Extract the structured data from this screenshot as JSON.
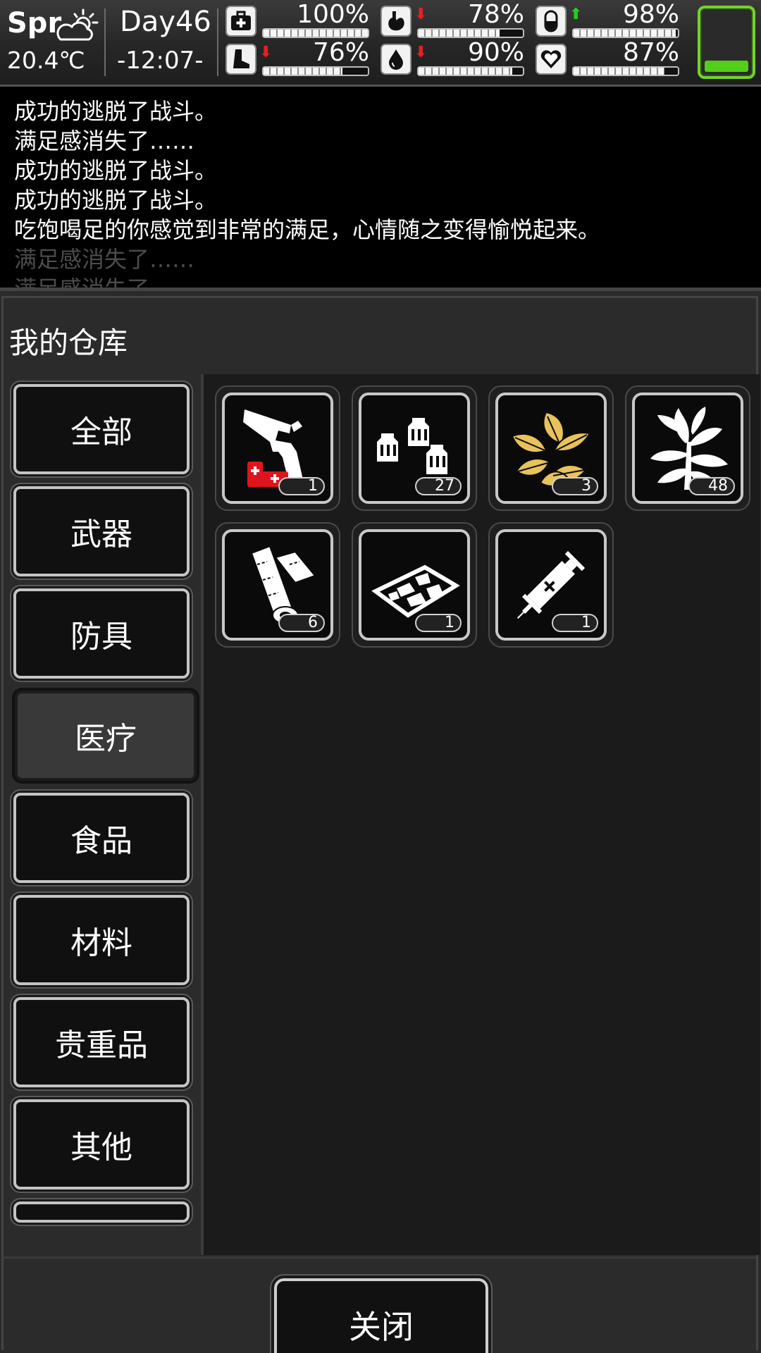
{
  "hud": {
    "season": "Spr",
    "weather_icon": "partly-cloudy-sun-icon",
    "temperature": "20.4℃",
    "day": "Day46",
    "clock": "-12:07-",
    "stats": [
      {
        "icon": "first-aid-kit-icon",
        "value": "100%",
        "level": 1.0,
        "trend": ""
      },
      {
        "icon": "stomach-icon",
        "value": "78%",
        "level": 0.78,
        "trend": "down"
      },
      {
        "icon": "pill-capsule-icon",
        "value": "98%",
        "level": 0.98,
        "trend": "up"
      },
      {
        "icon": "boot-icon",
        "value": "76%",
        "level": 0.76,
        "trend": "down"
      },
      {
        "icon": "water-drop-icon",
        "value": "90%",
        "level": 0.9,
        "trend": "down"
      },
      {
        "icon": "heart-icon",
        "value": "87%",
        "level": 0.87,
        "trend": ""
      }
    ],
    "trend_glyphs": {
      "down": "⬇",
      "up": "⬆"
    },
    "colors": {
      "trend_down": "#e62020",
      "trend_up": "#22d022",
      "status_box": "#74d22b"
    }
  },
  "log": {
    "lines": [
      {
        "text": "成功的逃脱了战斗。",
        "dim": false
      },
      {
        "text": "满足感消失了……",
        "dim": false
      },
      {
        "text": "成功的逃脱了战斗。",
        "dim": false
      },
      {
        "text": "成功的逃脱了战斗。",
        "dim": false
      },
      {
        "text": "吃饱喝足的你感觉到非常的满足，心情随之变得愉悦起来。",
        "dim": false
      },
      {
        "text": "满足感消失了……",
        "dim": true
      },
      {
        "text": "满足感消失了……",
        "dim": true
      }
    ]
  },
  "warehouse": {
    "title": "我的仓库",
    "categories": [
      {
        "label": "全部",
        "selected": false
      },
      {
        "label": "武器",
        "selected": false
      },
      {
        "label": "防具",
        "selected": false
      },
      {
        "label": "医疗",
        "selected": true
      },
      {
        "label": "食品",
        "selected": false
      },
      {
        "label": "材料",
        "selected": false
      },
      {
        "label": "贵重品",
        "selected": false
      },
      {
        "label": "其他",
        "selected": false
      }
    ],
    "items": [
      {
        "icon": "flare-gun-icon",
        "count": "1"
      },
      {
        "icon": "medicine-vials-icon",
        "count": "27"
      },
      {
        "icon": "golden-herb-leaves-icon",
        "count": "3"
      },
      {
        "icon": "herb-plant-icon",
        "count": "48"
      },
      {
        "icon": "bandage-rolls-icon",
        "count": "6"
      },
      {
        "icon": "pill-tray-icon",
        "count": "1"
      },
      {
        "icon": "syringe-icon",
        "count": "1"
      }
    ],
    "close_label": "关闭"
  }
}
